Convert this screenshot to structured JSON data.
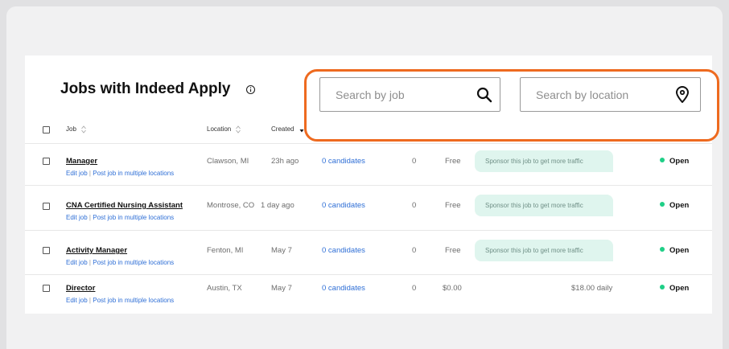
{
  "page": {
    "title": "Jobs with Indeed Apply"
  },
  "search": {
    "job_placeholder": "Search by job",
    "location_placeholder": "Search by location"
  },
  "table": {
    "headers": {
      "job": "Job",
      "location": "Location",
      "created": "Created"
    },
    "sub_links": {
      "edit": "Edit job",
      "separator": "|",
      "multi": "Post job in multiple locations"
    },
    "rows": [
      {
        "title": "Manager",
        "location": "Clawson, MI",
        "created": "23h ago",
        "candidates": "0 candidates",
        "count": "0",
        "cost": "Free",
        "sponsor": "Sponsor this job to get more traffic",
        "status": "Open"
      },
      {
        "title": "CNA Certified Nursing Assistant",
        "location": "Montrose, CO",
        "created": "1 day ago",
        "candidates": "0 candidates",
        "count": "0",
        "cost": "Free",
        "sponsor": "Sponsor this job to get more traffic",
        "status": "Open"
      },
      {
        "title": "Activity Manager",
        "location": "Fenton, MI",
        "created": "May 7",
        "candidates": "0 candidates",
        "count": "0",
        "cost": "Free",
        "sponsor": "Sponsor this job to get more traffic",
        "status": "Open"
      },
      {
        "title": "Director",
        "location": "Austin, TX",
        "created": "May 7",
        "candidates": "0 candidates",
        "count": "0",
        "cost": "$0.00",
        "budget": "$18.00 daily",
        "status": "Open"
      }
    ]
  },
  "colors": {
    "accent_outline": "#ee6a1f",
    "link": "#2f6fd6",
    "status_open": "#1fcf87",
    "sponsor_bg": "#dff5ee"
  }
}
